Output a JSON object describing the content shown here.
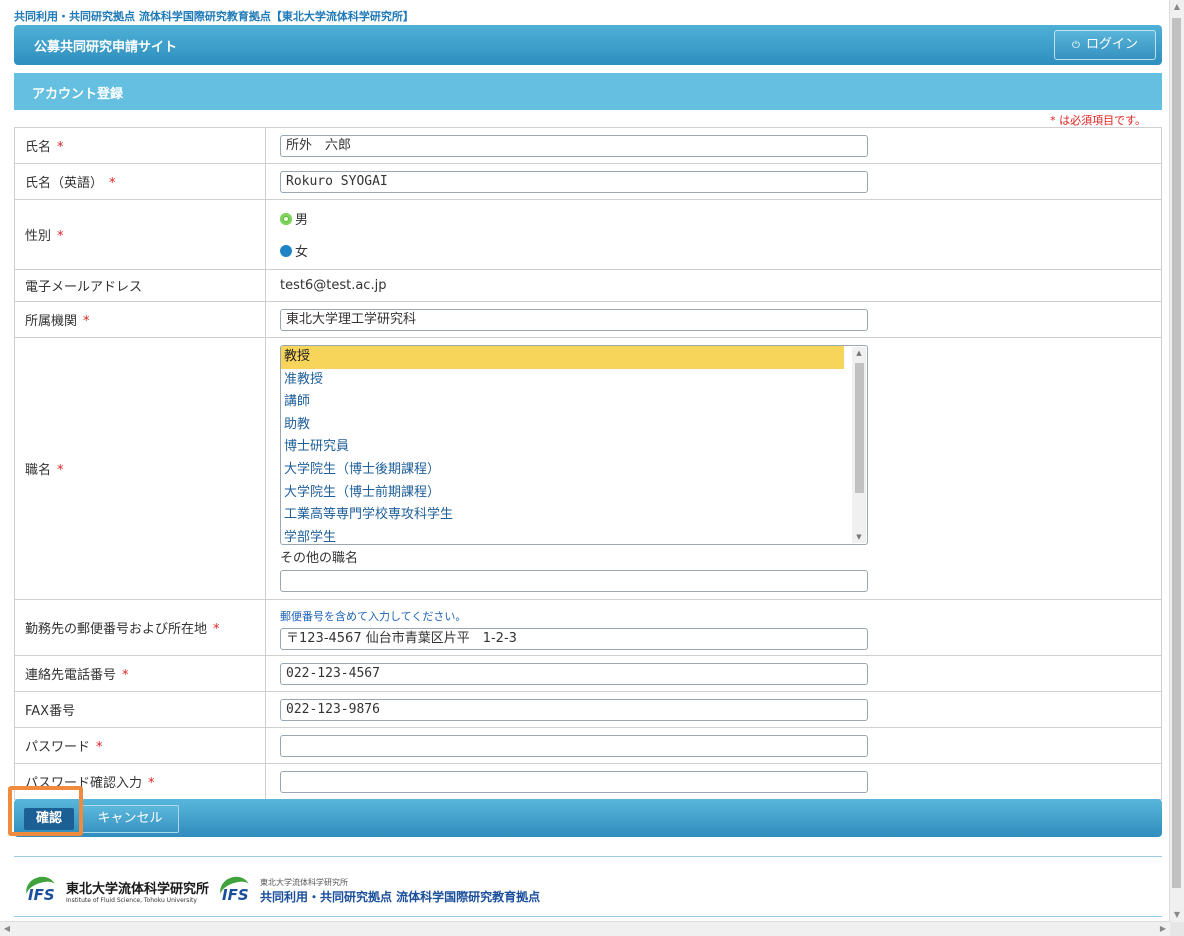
{
  "site": {
    "top_title": "共同利用・共同研究拠点 流体科学国際研究教育拠点【東北大学流体科学研究所】",
    "header_title": "公募共同研究申請サイト",
    "login_label": "ログイン"
  },
  "section": {
    "title": "アカウント登録",
    "required_note": "* は必須項目です。"
  },
  "form": {
    "name": {
      "label": "氏名",
      "value": "所外　六郎"
    },
    "name_en": {
      "label": "氏名（英語）",
      "value": "Rokuro SYOGAI"
    },
    "gender": {
      "label": "性別",
      "male": "男",
      "female": "女"
    },
    "email": {
      "label": "電子メールアドレス",
      "value": "test6@test.ac.jp"
    },
    "affiliation": {
      "label": "所属機関",
      "value": "東北大学理工学研究科"
    },
    "position": {
      "label": "職名",
      "options": [
        "教授",
        "准教授",
        "講師",
        "助教",
        "博士研究員",
        "大学院生（博士後期課程）",
        "大学院生（博士前期課程）",
        "工業高等専門学校専攻科学生",
        "学部学生"
      ],
      "selected": "教授",
      "other_label": "その他の職名",
      "other_value": ""
    },
    "address": {
      "label": "勤務先の郵便番号および所在地",
      "hint": "郵便番号を含めて入力してください。",
      "value": "〒123-4567 仙台市青葉区片平　1-2-3"
    },
    "phone": {
      "label": "連絡先電話番号",
      "value": "022-123-4567"
    },
    "fax": {
      "label": "FAX番号",
      "value": "022-123-9876"
    },
    "password": {
      "label": "パスワード",
      "value": ""
    },
    "password_confirm": {
      "label": "パスワード確認入力",
      "value": ""
    },
    "required_mark": "*"
  },
  "actions": {
    "confirm_label": "確認",
    "cancel_label": "キャンセル"
  },
  "footer": {
    "logo1_icon": "IFS",
    "logo1_name": "東北大学流体科学研究所",
    "logo1_sub": "Institute of Fluid Science, Tohoku University",
    "logo2_icon": "IFS",
    "logo2_small": "東北大学流体科学研究所",
    "logo2_name": "共同利用・共同研究拠点 流体科学国際研究教育拠点"
  },
  "colors": {
    "accent": "#3a9ccc",
    "required": "#dd2222",
    "highlight": "#f08a3c",
    "selected_option": "#f7d55b"
  }
}
